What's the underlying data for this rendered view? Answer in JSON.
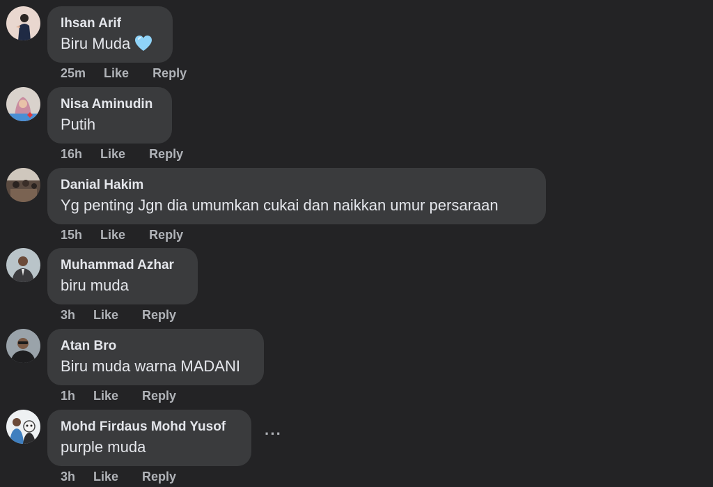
{
  "comments": [
    {
      "author": "Ihsan Arif",
      "text": "Biru Muda",
      "emoji": "light-blue-heart",
      "time": "25m",
      "like_label": "Like",
      "reply_label": "Reply"
    },
    {
      "author": "Nisa Aminudin",
      "text": "Putih",
      "time": "16h",
      "like_label": "Like",
      "reply_label": "Reply"
    },
    {
      "author": "Danial Hakim",
      "text": "Yg penting Jgn dia umumkan cukai dan naikkan umur persaraan",
      "time": "15h",
      "like_label": "Like",
      "reply_label": "Reply"
    },
    {
      "author": "Muhammad Azhar",
      "text": "biru muda",
      "time": "3h",
      "like_label": "Like",
      "reply_label": "Reply"
    },
    {
      "author": "Atan Bro",
      "text": "Biru muda warna MADANI",
      "time": "1h",
      "like_label": "Like",
      "reply_label": "Reply"
    },
    {
      "author": "Mohd Firdaus Mohd Yusof",
      "text": "purple muda",
      "time": "3h",
      "like_label": "Like",
      "reply_label": "Reply",
      "more_label": "···"
    }
  ],
  "colors": {
    "background": "#232325",
    "bubble": "#3a3b3d",
    "primary_text": "#e4e6eb",
    "secondary_text": "#b0b3b8",
    "heart": "#8fd3f8"
  },
  "icons": [
    "light-blue-heart-icon",
    "more-options-icon"
  ]
}
